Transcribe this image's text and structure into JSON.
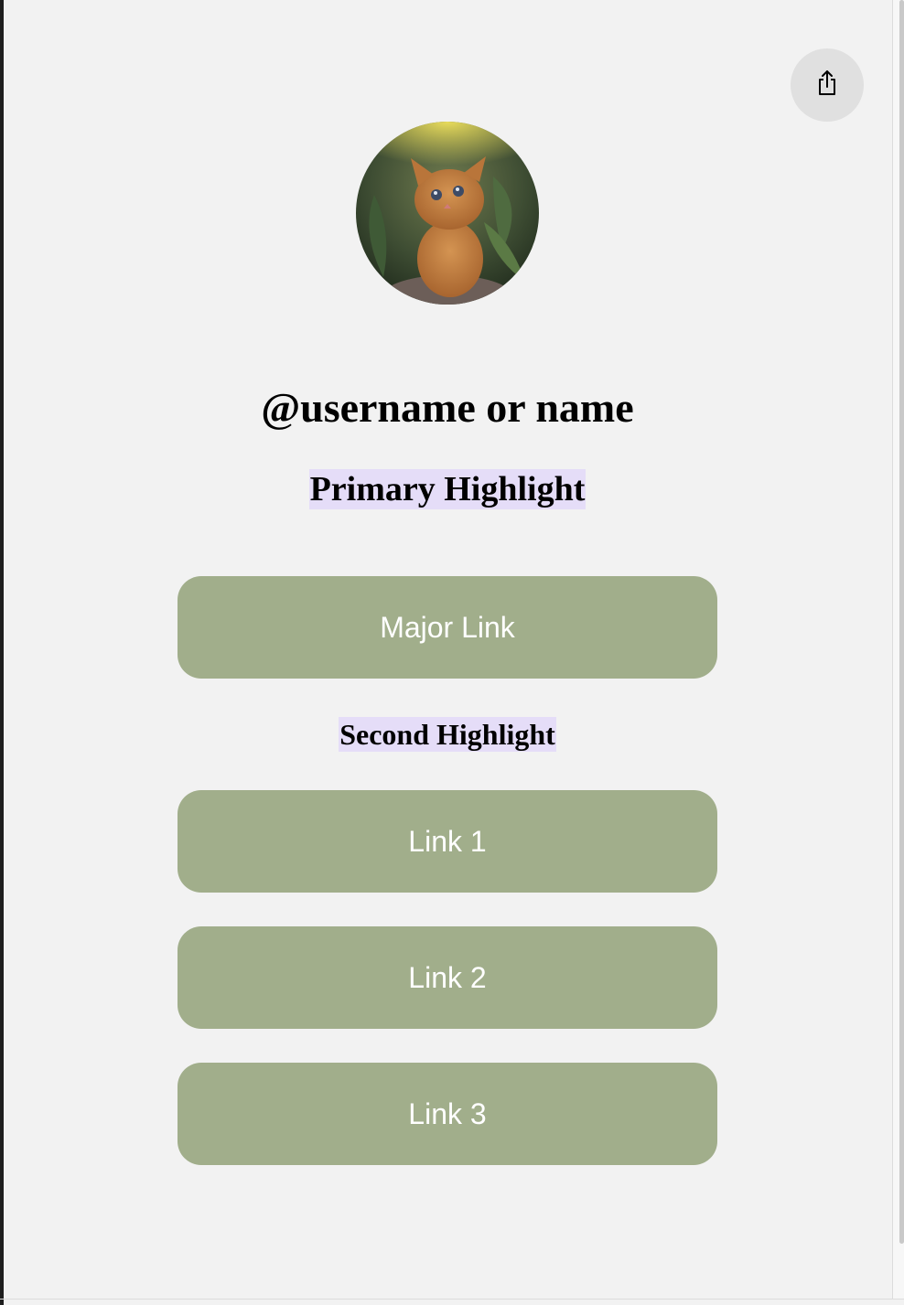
{
  "profile": {
    "title": "@username or name",
    "avatar_alt": "kitten photo"
  },
  "share": {
    "icon": "share-icon"
  },
  "highlights": {
    "primary": "Primary Highlight",
    "second": "Second Highlight"
  },
  "links": {
    "major": "Major Link",
    "link1": "Link 1",
    "link2": "Link 2",
    "link3": "Link 3"
  },
  "colors": {
    "background": "#f2f2f2",
    "button": "#a1ae8b",
    "button_text": "#ffffff",
    "highlight": "#e5ddf8",
    "share_button": "#e0e0e0"
  }
}
